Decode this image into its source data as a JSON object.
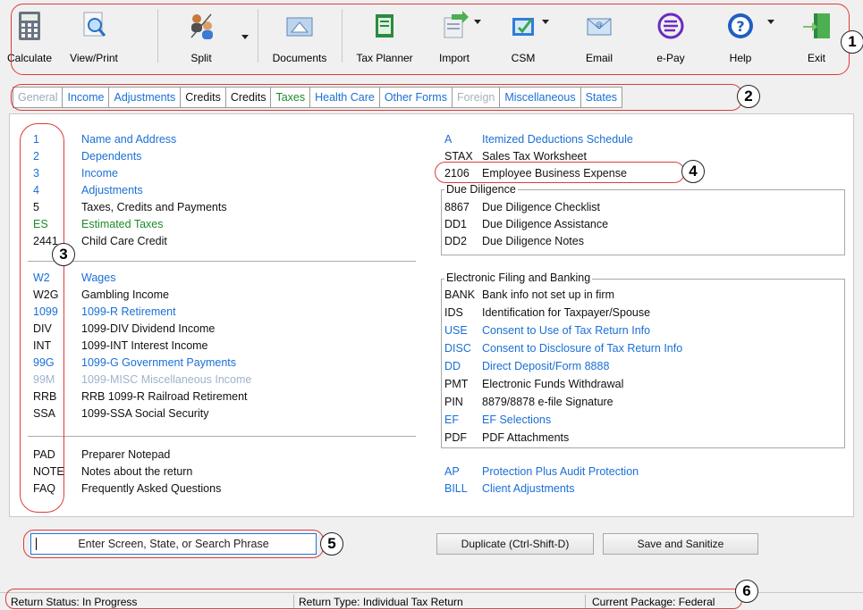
{
  "toolbar": {
    "calculate": "Calculate",
    "view_print": "View/Print",
    "split": "Split",
    "documents": "Documents",
    "tax_planner": "Tax Planner",
    "import": "Import",
    "csm": "CSM",
    "email": "Email",
    "epay": "e-Pay",
    "help": "Help",
    "exit": "Exit"
  },
  "tabs": [
    "General",
    "Income",
    "Adjustments",
    "Credits",
    "Credits",
    "Taxes",
    "Health Care",
    "Other Forms",
    "Foreign",
    "Miscellaneous",
    "States"
  ],
  "left_group1": [
    {
      "code": "1",
      "name": "Name and Address"
    },
    {
      "code": "2",
      "name": "Dependents"
    },
    {
      "code": "3",
      "name": "Income"
    },
    {
      "code": "4",
      "name": "Adjustments"
    },
    {
      "code": "5",
      "name": "Taxes, Credits and Payments"
    },
    {
      "code": "ES",
      "name": "Estimated Taxes"
    },
    {
      "code": "2441",
      "name": "Child Care Credit"
    }
  ],
  "left_group2": [
    {
      "code": "W2",
      "name": "Wages"
    },
    {
      "code": "W2G",
      "name": "Gambling Income"
    },
    {
      "code": "1099",
      "name": "1099-R  Retirement"
    },
    {
      "code": "DIV",
      "name": "1099-DIV  Dividend Income"
    },
    {
      "code": "INT",
      "name": "1099-INT  Interest Income"
    },
    {
      "code": "99G",
      "name": "1099-G  Government Payments"
    },
    {
      "code": "99M",
      "name": "1099-MISC  Miscellaneous Income"
    },
    {
      "code": "RRB",
      "name": "RRB 1099-R  Railroad Retirement"
    },
    {
      "code": "SSA",
      "name": "1099-SSA  Social Security"
    }
  ],
  "left_group3": [
    {
      "code": "PAD",
      "name": "Preparer Notepad"
    },
    {
      "code": "NOTE",
      "name": "Notes about the return"
    },
    {
      "code": "FAQ",
      "name": "Frequently Asked Questions"
    }
  ],
  "right_top": [
    {
      "code": "A",
      "name": "Itemized Deductions Schedule"
    },
    {
      "code": "STAX",
      "name": "Sales Tax Worksheet"
    },
    {
      "code": "2106",
      "name": "Employee Business Expense"
    }
  ],
  "due_diligence": {
    "title": "Due Diligence",
    "items": [
      {
        "code": "8867",
        "name": "Due Diligence Checklist"
      },
      {
        "code": "DD1",
        "name": "Due Diligence Assistance"
      },
      {
        "code": "DD2",
        "name": "Due Diligence Notes"
      }
    ]
  },
  "efiling": {
    "title": "Electronic Filing and Banking",
    "items": [
      {
        "code": "BANK",
        "name": "Bank info not set up in firm"
      },
      {
        "code": "IDS",
        "name": "Identification for Taxpayer/Spouse"
      },
      {
        "code": "USE",
        "name": "Consent to Use of Tax Return Info"
      },
      {
        "code": "DISC",
        "name": "Consent to Disclosure of Tax Return Info"
      },
      {
        "code": "DD",
        "name": "Direct Deposit/Form 8888"
      },
      {
        "code": "PMT",
        "name": "Electronic Funds Withdrawal"
      },
      {
        "code": "PIN",
        "name": "8879/8878 e-file Signature"
      },
      {
        "code": "EF",
        "name": "EF Selections"
      },
      {
        "code": "PDF",
        "name": "PDF Attachments"
      }
    ]
  },
  "right_bottom": [
    {
      "code": "AP",
      "name": "Protection Plus Audit Protection"
    },
    {
      "code": "BILL",
      "name": "Client Adjustments"
    }
  ],
  "search": {
    "placeholder": "Enter Screen, State, or Search Phrase"
  },
  "buttons": {
    "duplicate": "Duplicate (Ctrl-Shift-D)",
    "save_sanitize": "Save and Sanitize"
  },
  "status": {
    "return_status": "Return Status: In Progress",
    "return_type": "Return Type: Individual Tax Return",
    "package": "Current Package: Federal"
  },
  "callouts": [
    "1",
    "2",
    "3",
    "4",
    "5",
    "6"
  ],
  "colors": {
    "link": "#1a6fd6",
    "green": "#1f8a2a",
    "callout": "#e03a3a"
  }
}
